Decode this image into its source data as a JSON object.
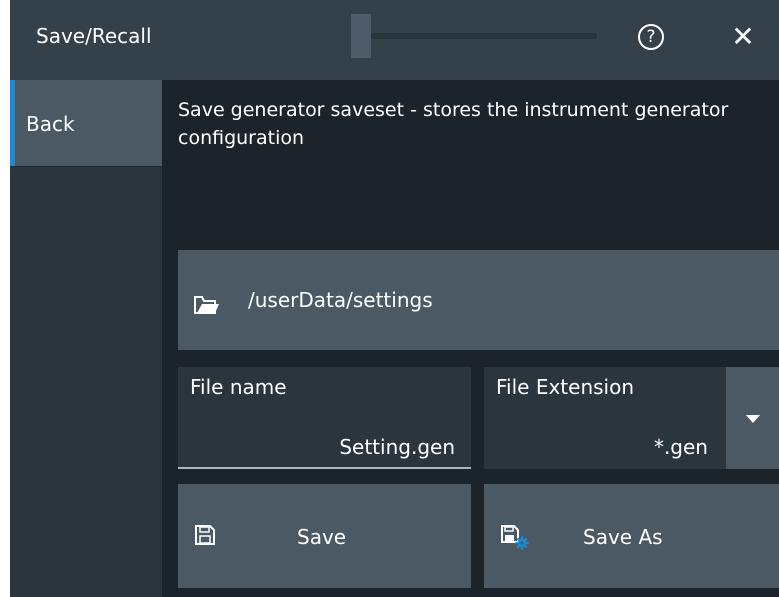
{
  "window": {
    "title": "Save/Recall",
    "help_label": "?",
    "close_label": "✕"
  },
  "sidebar": {
    "back_label": "Back"
  },
  "main": {
    "description": "Save generator saveset - stores the instrument generator configuration",
    "path": "/userData/settings",
    "file_name": {
      "label": "File name",
      "value": "Setting.gen"
    },
    "file_extension": {
      "label": "File Extension",
      "value": "*.gen"
    },
    "save_label": "Save",
    "save_as_label": "Save As"
  },
  "colors": {
    "accent": "#1e8ad6",
    "titlebar": "#34414b",
    "background": "#1c242b",
    "button": "#4b5964",
    "field": "#2b353e"
  }
}
